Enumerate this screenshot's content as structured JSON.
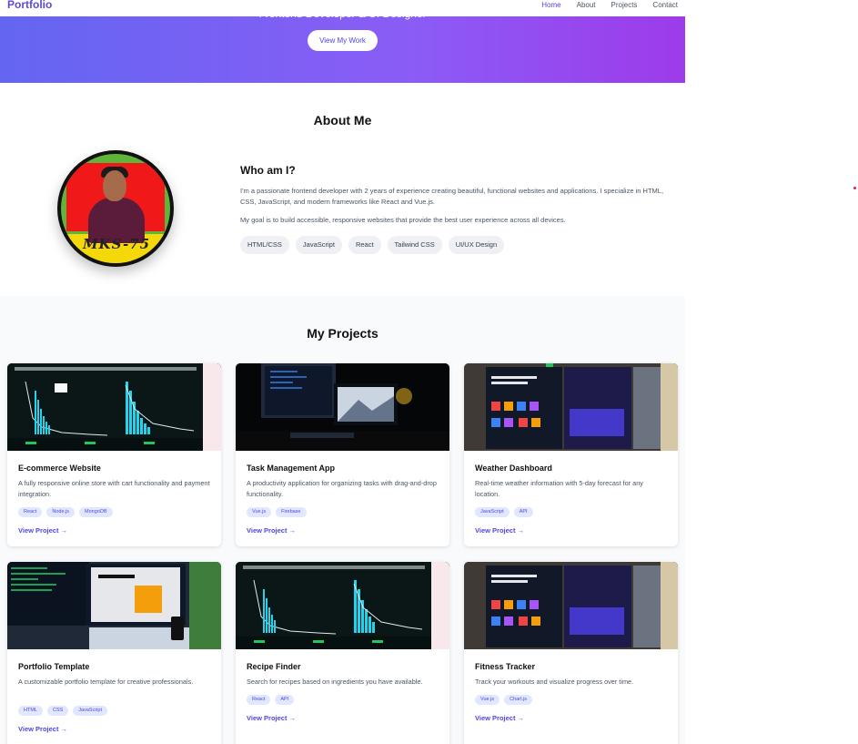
{
  "nav": {
    "logo": "Portfolio",
    "links": [
      {
        "label": "Home",
        "active": true
      },
      {
        "label": "About",
        "active": false
      },
      {
        "label": "Projects",
        "active": false
      },
      {
        "label": "Contact",
        "active": false
      }
    ]
  },
  "hero": {
    "subtitle": "Frontend Developer & UI Designer",
    "button": "View My Work"
  },
  "about": {
    "title": "About Me",
    "avatar_signature": "MKS-75",
    "heading": "Who am I?",
    "paragraph1": "I'm a passionate frontend developer with 2 years of experience creating beautiful, functional websites and applications. I specialize in HTML, CSS, JavaScript, and modern frameworks like React and Vue.js.",
    "paragraph2": "My goal is to build accessible, responsive websites that provide the best user experience across all devices.",
    "skills": [
      "HTML/CSS",
      "JavaScript",
      "React",
      "Tailwind CSS",
      "UI/UX Design"
    ]
  },
  "projects": {
    "title": "My Projects",
    "link_label": "View Project →",
    "items": [
      {
        "title": "E-commerce Website",
        "description": "A fully responsive online store with cart functionality and payment integration.",
        "tags": [
          "React",
          "Node.js",
          "MongoDB"
        ],
        "image": "chart-dashboard"
      },
      {
        "title": "Task Management App",
        "description": "A productivity application for organizing tasks with drag-and-drop functionality.",
        "tags": [
          "Vue.js",
          "Firebase"
        ],
        "image": "desk-monitors"
      },
      {
        "title": "Weather Dashboard",
        "description": "Real-time weather information with 5-day forecast for any location.",
        "tags": [
          "JavaScript",
          "API"
        ],
        "image": "web-design-screens"
      },
      {
        "title": "Portfolio Template",
        "description": "A customizable portfolio template for creative professionals.",
        "tags": [
          "HTML",
          "CSS",
          "JavaScript"
        ],
        "image": "laptop-desk"
      },
      {
        "title": "Recipe Finder",
        "description": "Search for recipes based on ingredients you have available.",
        "tags": [
          "React",
          "API"
        ],
        "image": "chart-dashboard"
      },
      {
        "title": "Fitness Tracker",
        "description": "Track your workouts and visualize progress over time.",
        "tags": [
          "Vue.js",
          "Chart.js"
        ],
        "image": "web-design-screens"
      }
    ]
  },
  "colors": {
    "accent": "#4f46e5",
    "hero_start": "#6366f1",
    "hero_end": "#9d3bea"
  }
}
